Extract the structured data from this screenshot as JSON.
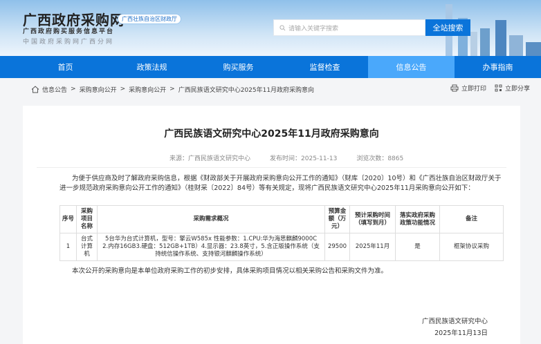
{
  "header": {
    "title": "广西政府采购网",
    "badge": "广西壮族自治区财政厅",
    "subtitle": "广西政府购买服务信息平台",
    "subtitle2": "中国政府采购网广西分网",
    "search_placeholder": "请输入关键字搜索",
    "search_button": "全站搜索"
  },
  "nav": [
    "首页",
    "政策法规",
    "购买服务",
    "监督检查",
    "信息公告",
    "办事指南"
  ],
  "breadcrumb": [
    "信息公告",
    "采购意向公开",
    "采购意向公开",
    "广西民族语文研究中心2025年11月政府采购意向"
  ],
  "tools": {
    "print": "立即打印",
    "share": "立即分享"
  },
  "article": {
    "title": "广西民族语文研究中心2025年11月政府采购意向",
    "source": "来源：广西民族语文研究中心",
    "date": "发布时间：2025-11-13",
    "views": "浏览次数：8865",
    "intro": "为便于供应商及时了解政府采购信息，根据《财政部关于开展政府采购意向公开工作的通知》（财库〔2020〕10号）和《广西壮族自治区财政厅关于进一步规范政府采购意向公开工作的通知》（桂财采〔2022〕84号）等有关规定，现将广西民族语文研究中心2025年11月采购意向公开如下：",
    "table": {
      "headers": [
        "序号",
        "采购项目名称",
        "采购需求概况",
        "预算金额（万元）",
        "预计采购时间（填写到月）",
        "落实政府采购政策功能情况",
        "备注"
      ],
      "rows": [
        [
          "1",
          "台式计算机",
          "5台华为台式计算机，型号：擎云W585x 性能参数：1.CPU:华为海思麒麟9000C 2.内存16GB3.硬盘：512GB+1TB）4.显示器：23.8英寸，5.含正版操作系统（支持统信操作系统、支持银河麒麟操作系统）",
          "29500",
          "2025年11月",
          "是",
          "框架协议采购"
        ]
      ]
    },
    "closing": "本次公开的采购意向是本单位政府采购工作的初步安排，具体采购项目情况以相关采购公告和采购文件为准。",
    "signature": "广西民族语文研究中心",
    "sign_date": "2025年11月13日"
  }
}
